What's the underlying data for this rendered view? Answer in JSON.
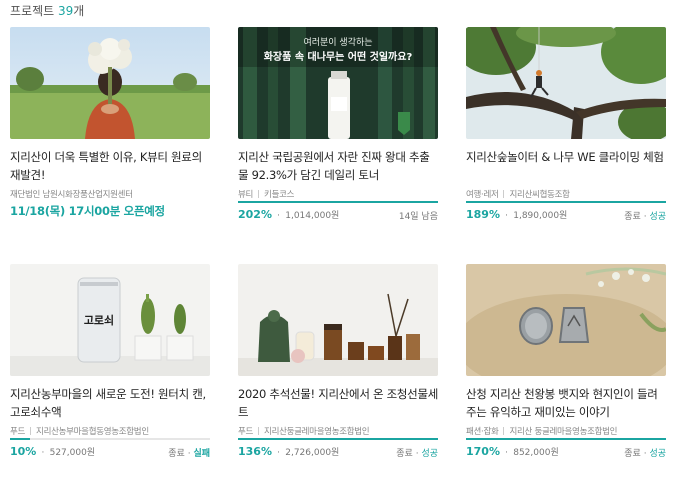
{
  "header": {
    "label": "프로젝트",
    "count": "39",
    "suffix": "개"
  },
  "projects": [
    {
      "title": "지리산이 더욱 특별한 이유, K뷰티 원료의 재발견!",
      "meta": [
        "재단법인 남원시화장품산업지원센터"
      ],
      "open_notice": "11/18(목) 17시00분 오픈예정"
    },
    {
      "title": "지리산 국립공원에서 자란 진짜 왕대 추출물 92.3%가 담긴 데일리 토너",
      "meta": [
        "뷰티",
        "키들코스"
      ],
      "percent": "202%",
      "amount": "1,014,000원",
      "right": "14일 남음",
      "progress": 1.0,
      "image_text": {
        "line1": "여러분이 생각하는",
        "line2": "화장품 속 대나무는 어떤 것일까요?"
      }
    },
    {
      "title": "지리산숲놀이터 & 나무 WE 클라이밍 체험",
      "meta": [
        "여행·레저",
        "지리산씨협동조합"
      ],
      "percent": "189%",
      "amount": "1,890,000원",
      "status_prefix": "종료",
      "status": "성공",
      "progress": 1.0
    },
    {
      "title": "지리산농부마을의 새로운 도전! 원터치 캔, 고로쇠수액",
      "meta": [
        "푸드",
        "지리산농부마을협동영농조합법인"
      ],
      "percent": "10%",
      "amount": "527,000원",
      "status_prefix": "종료",
      "status": "실패",
      "progress": 0.1,
      "image_text": {
        "label": "고로쇠"
      }
    },
    {
      "title": "2020 추석선물! 지리산에서 온 조청선물세트",
      "meta": [
        "푸드",
        "지리산둥글레마을영농조합법인"
      ],
      "percent": "136%",
      "amount": "2,726,000원",
      "status_prefix": "종료",
      "status": "성공",
      "progress": 1.0
    },
    {
      "title": "산청 지리산 천왕봉 뱃지와 현지인이 들려주는 유익하고 재미있는 이야기",
      "meta": [
        "패션·잡화",
        "지리산 둥글레마을영농조합법인"
      ],
      "percent": "170%",
      "amount": "852,000원",
      "status_prefix": "종료",
      "status": "성공",
      "progress": 1.0
    }
  ],
  "colors": {
    "accent": "#1ba5a1",
    "track": "#e6e6e6"
  }
}
